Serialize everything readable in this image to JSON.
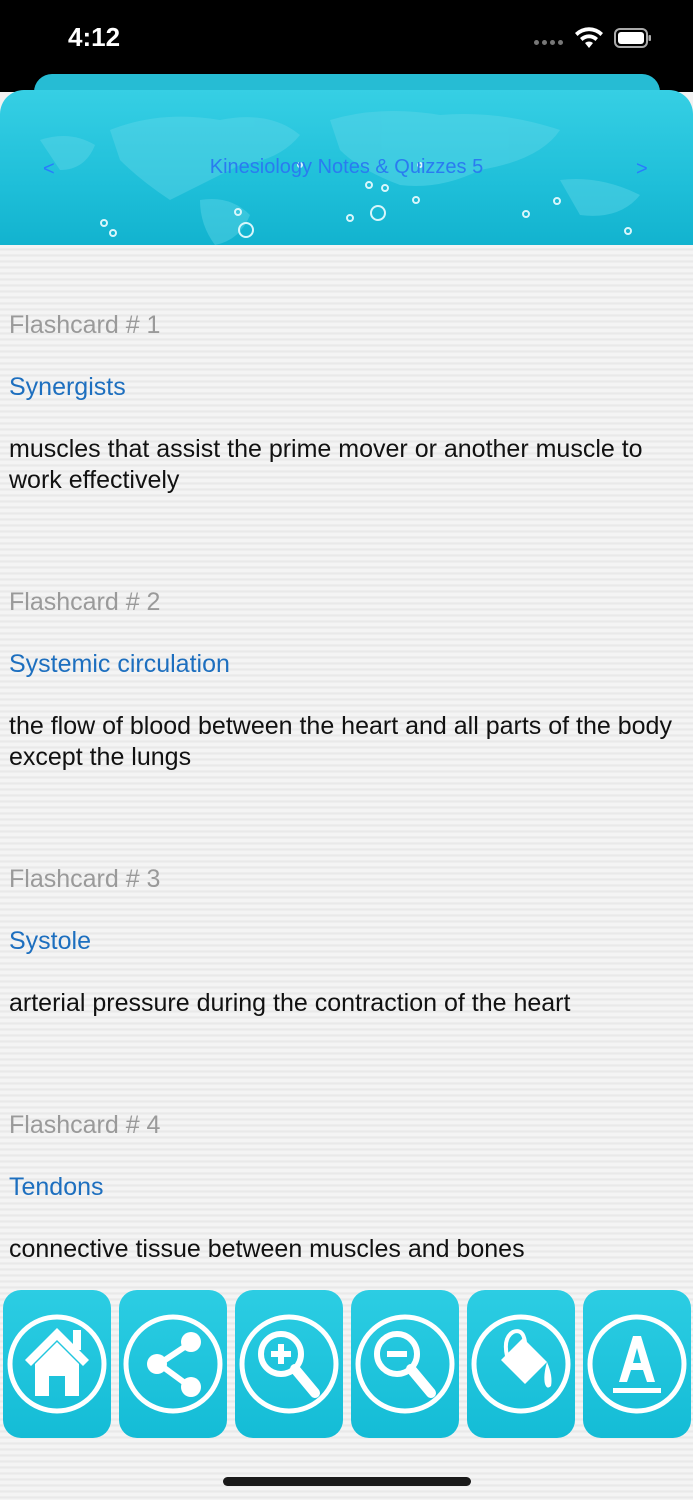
{
  "status_bar": {
    "time": "4:12"
  },
  "header": {
    "prev_label": "<",
    "title": "Kinesiology Notes & Quizzes 5",
    "next_label": ">"
  },
  "flashcards": [
    {
      "number": "Flashcard # 1",
      "term": "Synergists",
      "definition": "muscles that assist the prime mover or another muscle to work effectively"
    },
    {
      "number": "Flashcard # 2",
      "term": "Systemic circulation",
      "definition": "the flow of blood between the heart and all parts of the body except the lungs"
    },
    {
      "number": "Flashcard # 3",
      "term": "Systole",
      "definition": "arterial pressure during the contraction of the heart"
    },
    {
      "number": "Flashcard # 4",
      "term": "Tendons",
      "definition": "connective tissue between muscles and bones"
    }
  ],
  "toolbar": {
    "buttons": [
      "home-icon",
      "share-icon",
      "zoom-in-icon",
      "zoom-out-icon",
      "paint-bucket-icon",
      "font-icon"
    ]
  },
  "colors": {
    "header": "#1fbfd9",
    "term": "#1d6fbf",
    "card_number": "#9a9a9a",
    "nav": "#2a7bf0"
  }
}
